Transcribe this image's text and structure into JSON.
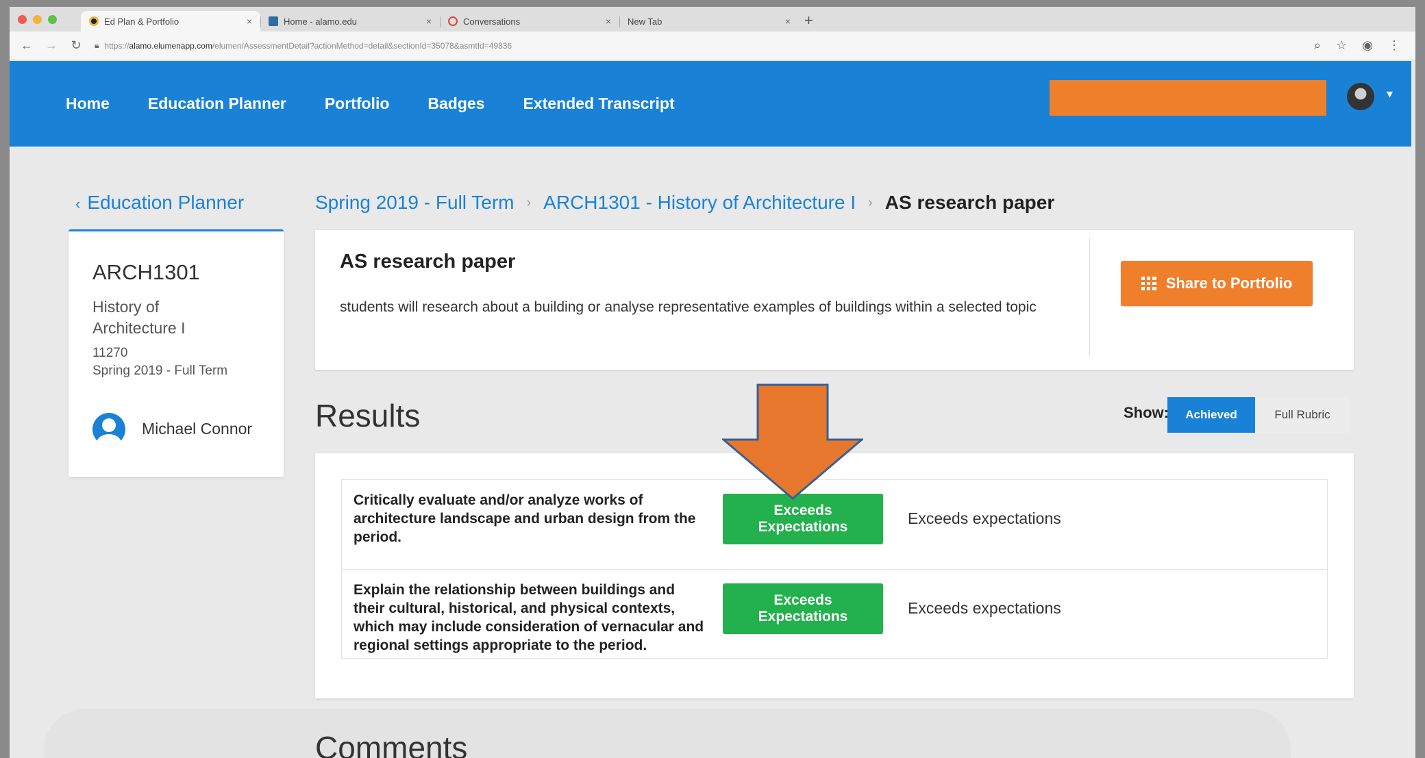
{
  "browser": {
    "tabs": [
      {
        "title": "Ed Plan & Portfolio",
        "favicon_color": "#222222",
        "active": true
      },
      {
        "title": "Home - alamo.edu",
        "favicon_color": "#2e6da4",
        "active": false
      },
      {
        "title": "Conversations",
        "favicon_color": "#e0453a",
        "active": false
      },
      {
        "title": "New Tab",
        "favicon_color": "",
        "active": false
      }
    ],
    "url_prefix": "https://",
    "url_host": "alamo.elumenapp.com",
    "url_path": "/elumen/AssessmentDetail?actionMethod=detail&sectionId=35078&asmtId=49836"
  },
  "appbar": {
    "nav": [
      "Home",
      "Education Planner",
      "Portfolio",
      "Badges",
      "Extended Transcript"
    ],
    "accent": "#1a82d6",
    "redaction_color": "#f07f2c"
  },
  "sidebar": {
    "back_label": "Education Planner",
    "course_code": "ARCH1301",
    "course_name": "History of Architecture I",
    "section_number": "11270",
    "term": "Spring 2019 - Full Term",
    "student_name": "Michael Connor"
  },
  "breadcrumb": {
    "term": "Spring 2019 - Full Term",
    "course": "ARCH1301 - History of Architecture I",
    "current": "AS research paper"
  },
  "assessment": {
    "title": "AS research paper",
    "description": "students will research about a building or analyse representative examples of buildings within a selected topic",
    "share_label": "Share to Portfolio"
  },
  "results": {
    "title": "Results",
    "show_label": "Show:",
    "toggle_selected": "Achieved",
    "toggle_other": "Full Rubric",
    "rows": [
      {
        "criterion": "Critically evaluate and/or analyze works of architecture landscape and urban design from the period.",
        "level": "Exceeds Expectations",
        "description": "Exceeds expectations"
      },
      {
        "criterion": "Explain the relationship between buildings and their cultural, historical, and physical contexts, which may include consideration of vernacular and regional settings appropriate to the period.",
        "level": "Exceeds Expectations",
        "description": "Exceeds expectations"
      }
    ]
  },
  "comments": {
    "title": "Comments"
  },
  "colors": {
    "success": "#22b14c",
    "share_button": "#f07f2c",
    "annotation_arrow": "#e8772e"
  }
}
